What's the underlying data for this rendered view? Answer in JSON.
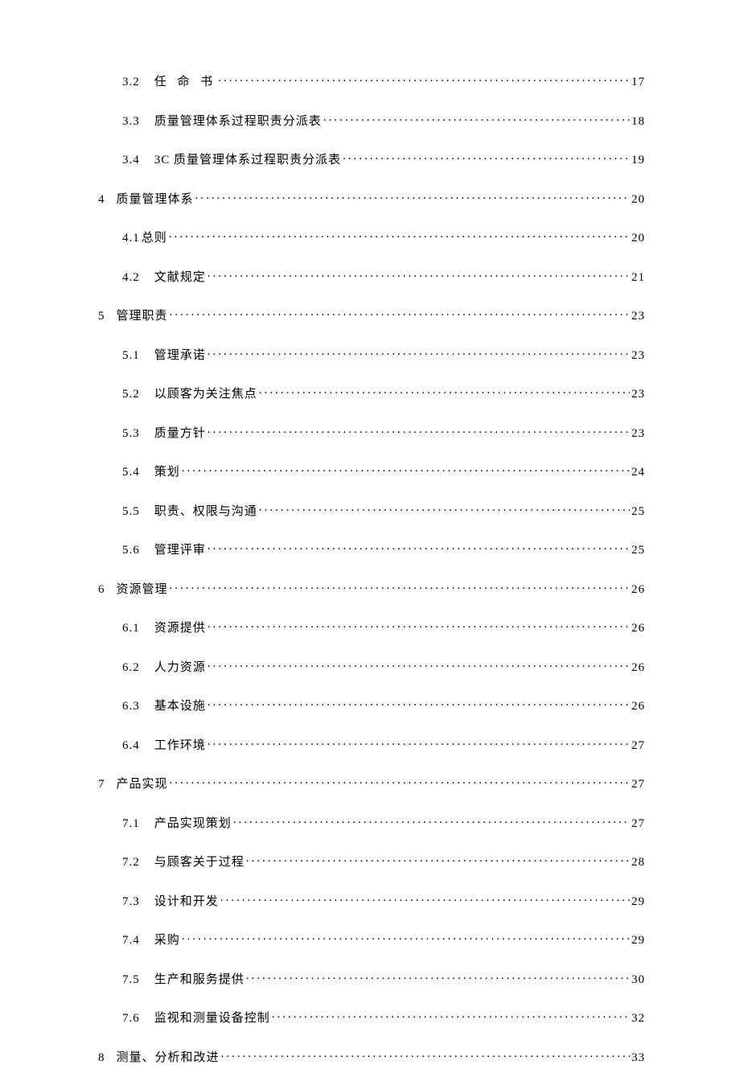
{
  "toc": [
    {
      "level": 2,
      "number": "3.2",
      "title": "任 命 书",
      "page": "17",
      "spaced": true
    },
    {
      "level": 2,
      "number": "3.3",
      "title": "质量管理体系过程职责分派表",
      "page": "18"
    },
    {
      "level": 2,
      "number": "3.4",
      "title": "3C 质量管理体系过程职责分派表",
      "page": "19"
    },
    {
      "level": 1,
      "number": "4",
      "title": "质量管理体系",
      "page": "20"
    },
    {
      "level": 2,
      "number": "4.1",
      "title": "总则",
      "page": "20",
      "nogap": true
    },
    {
      "level": 2,
      "number": "4.2",
      "title": "文献规定",
      "page": "21"
    },
    {
      "level": 1,
      "number": "5",
      "title": "管理职责",
      "page": "23"
    },
    {
      "level": 2,
      "number": "5.1",
      "title": "管理承诺",
      "page": "23"
    },
    {
      "level": 2,
      "number": "5.2",
      "title": "以顾客为关注焦点",
      "page": "23"
    },
    {
      "level": 2,
      "number": "5.3",
      "title": "质量方针",
      "page": "23"
    },
    {
      "level": 2,
      "number": "5.4",
      "title": "策划",
      "page": "24"
    },
    {
      "level": 2,
      "number": "5.5",
      "title": "职责、权限与沟通",
      "page": "25"
    },
    {
      "level": 2,
      "number": "5.6",
      "title": "管理评审",
      "page": "25"
    },
    {
      "level": 1,
      "number": "6",
      "title": "资源管理",
      "page": "26"
    },
    {
      "level": 2,
      "number": "6.1",
      "title": "资源提供",
      "page": "26"
    },
    {
      "level": 2,
      "number": "6.2",
      "title": "人力资源",
      "page": "26"
    },
    {
      "level": 2,
      "number": "6.3",
      "title": "基本设施",
      "page": "26"
    },
    {
      "level": 2,
      "number": "6.4",
      "title": "工作环境",
      "page": "27"
    },
    {
      "level": 1,
      "number": "7",
      "title": "产品实现",
      "page": "27"
    },
    {
      "level": 2,
      "number": "7.1",
      "title": "产品实现策划",
      "page": "27"
    },
    {
      "level": 2,
      "number": "7.2",
      "title": "与顾客关于过程",
      "page": "28"
    },
    {
      "level": 2,
      "number": "7.3",
      "title": "设计和开发",
      "page": "29"
    },
    {
      "level": 2,
      "number": "7.4",
      "title": "采购",
      "page": "29"
    },
    {
      "level": 2,
      "number": "7.5",
      "title": "生产和服务提供",
      "page": "30"
    },
    {
      "level": 2,
      "number": "7.6",
      "title": "监视和测量设备控制",
      "page": "32"
    },
    {
      "level": 1,
      "number": "8",
      "title": "测量、分析和改进",
      "page": "33"
    }
  ]
}
